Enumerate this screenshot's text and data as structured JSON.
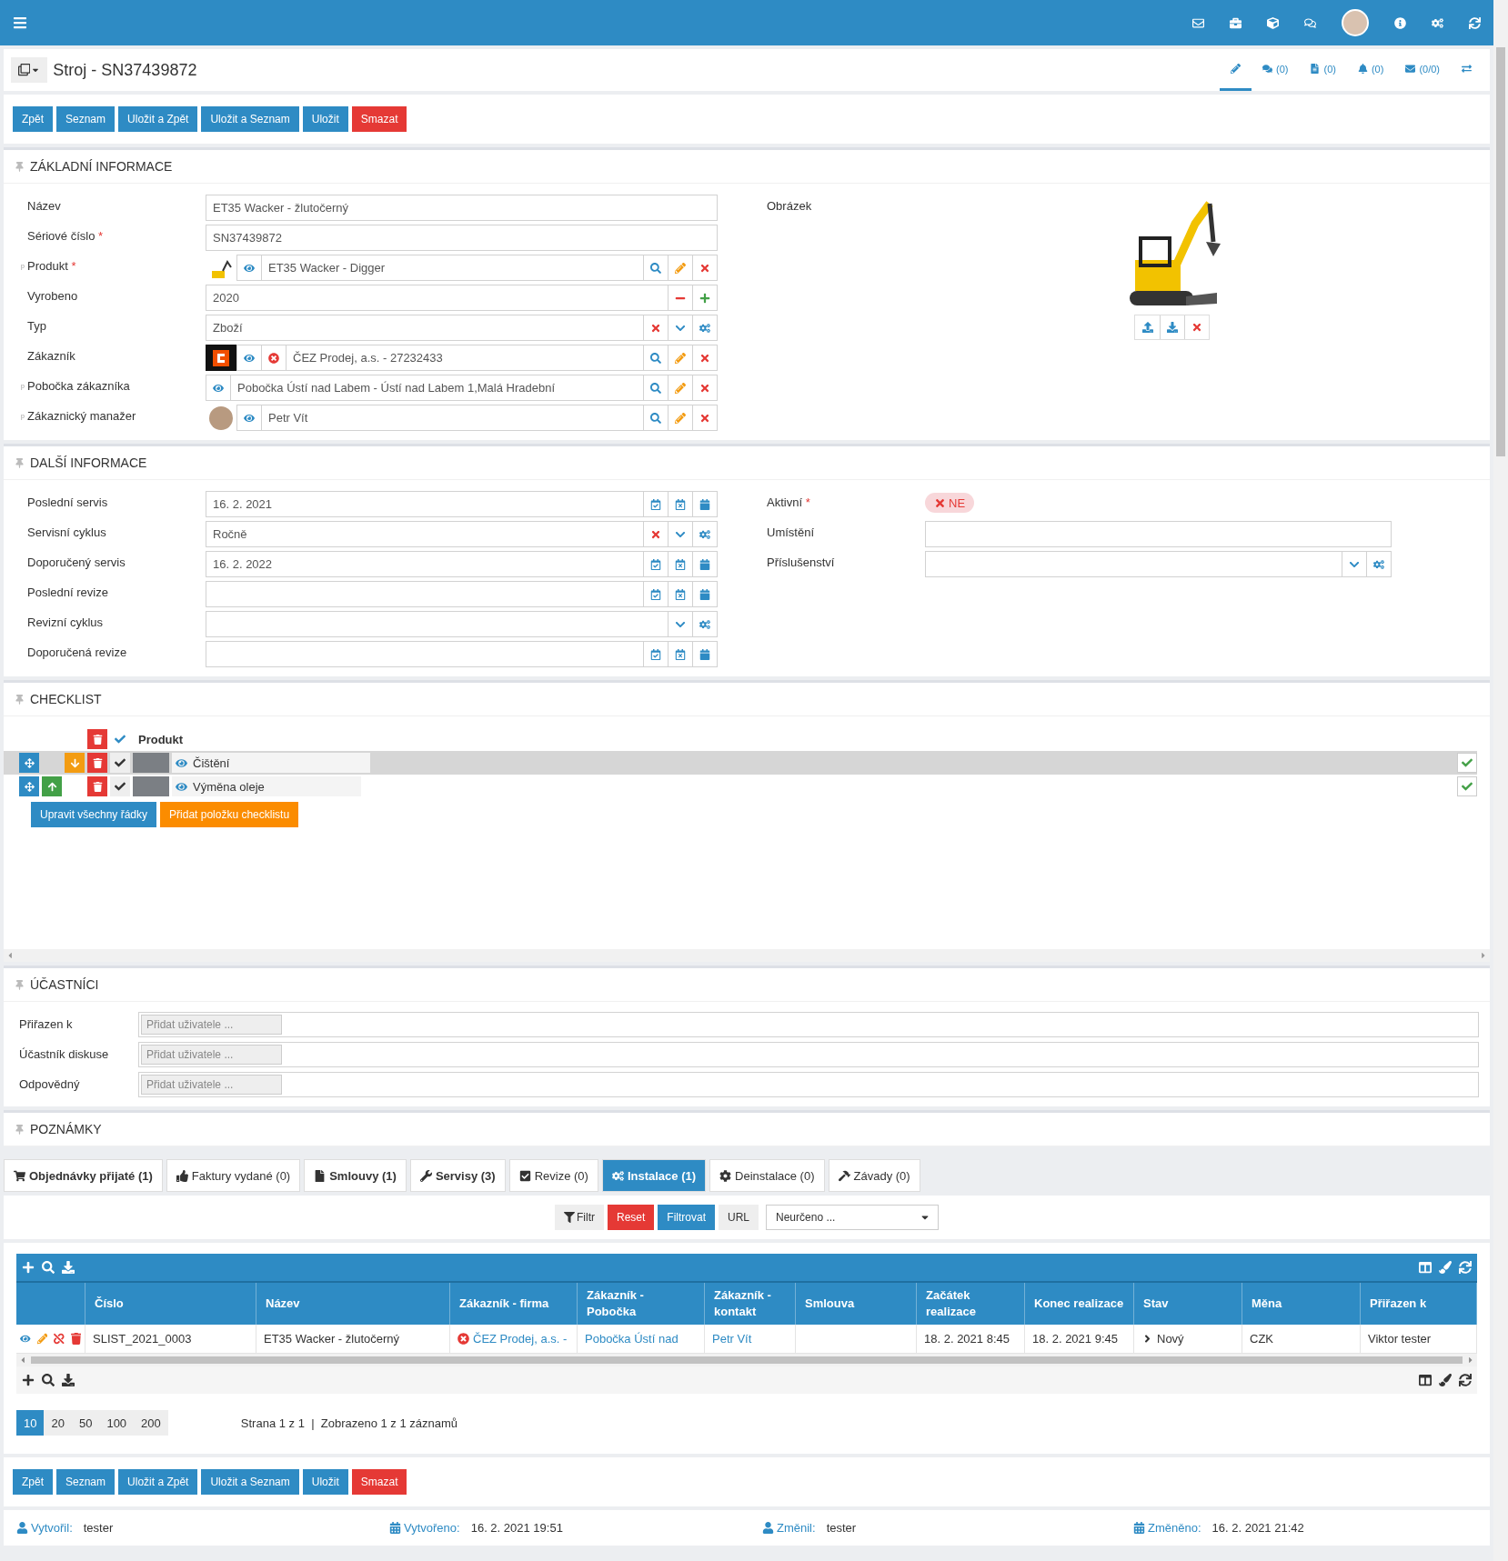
{
  "header": {
    "title": "Stroj - SN37439872",
    "tabs": [
      {
        "kind": "edit",
        "selected": true
      },
      {
        "kind": "comments",
        "count": "(0)",
        "selected": false
      },
      {
        "kind": "documents",
        "count": "(0)",
        "selected": false
      },
      {
        "kind": "bell",
        "count": "(0)",
        "selected": false
      },
      {
        "kind": "mail",
        "count": "(0/0)",
        "selected": false
      },
      {
        "kind": "swap",
        "selected": false
      }
    ]
  },
  "actions_top": [
    {
      "label": "Zpět",
      "kind": "primary"
    },
    {
      "label": "Seznam",
      "kind": "primary"
    },
    {
      "label": "Uložit a Zpět",
      "kind": "primary"
    },
    {
      "label": "Uložit a Seznam",
      "kind": "primary"
    },
    {
      "label": "Uložit",
      "kind": "primary"
    },
    {
      "label": "Smazat",
      "kind": "danger"
    }
  ],
  "basic": {
    "title": "ZÁKLADNÍ INFORMACE",
    "fields": [
      {
        "label": "Název",
        "kind": "text",
        "value": "ET35 Wacker - žlutočerný"
      },
      {
        "label": "Sériové číslo",
        "required_mark": "*",
        "kind": "text",
        "value": "SN37439872"
      },
      {
        "label": "Produkt",
        "prefix": "p",
        "required_mark": "*",
        "kind": "lookup",
        "thumb": {
          "kind": "machine"
        },
        "value": "ET35 Wacker - Digger"
      },
      {
        "label": "Vyrobeno",
        "kind": "number",
        "value": "2020"
      },
      {
        "label": "Typ",
        "kind": "select",
        "value": "Zboží"
      },
      {
        "label": "Zákazník",
        "kind": "lookup",
        "thumb": {
          "kind": "logo"
        },
        "unlink": true,
        "value": "ČEZ Prodej, a.s. - 27232433"
      },
      {
        "label": "Pobočka zákazníka",
        "prefix": "p",
        "kind": "lookup",
        "value": "Pobočka Ústí nad Labem - Ústí nad Labem 1,Malá Hradební"
      },
      {
        "label": "Zákaznický manažer",
        "prefix": "p",
        "kind": "lookup",
        "thumb": {
          "kind": "person"
        },
        "value": "Petr Vít"
      }
    ],
    "image": {
      "label": "Obrázek"
    }
  },
  "more": {
    "title": "DALŠÍ INFORMACE",
    "fields": [
      {
        "label": "Poslední servis",
        "kind": "date",
        "value": "16. 2. 2021"
      },
      {
        "label": "Servisní cyklus",
        "kind": "select",
        "value": "Ročně"
      },
      {
        "label": "Doporučený servis",
        "kind": "date",
        "value": "16. 2. 2022"
      },
      {
        "label": "Poslední revize",
        "kind": "date"
      },
      {
        "label": "Revizní cyklus",
        "kind": "choice"
      },
      {
        "label": "Doporučená revize",
        "kind": "date"
      }
    ],
    "right": [
      {
        "label": "Aktivní",
        "required_mark": "*",
        "kind": "toggle",
        "on": false,
        "value": "NE"
      },
      {
        "label": "Umístění",
        "kind": "text"
      },
      {
        "label": "Příslušenství",
        "kind": "choice"
      }
    ]
  },
  "checklist": {
    "title": "CHECKLIST",
    "heading": "Produkt",
    "items": [
      {
        "label": "Čištění",
        "up": false,
        "down": true,
        "done": true,
        "selected": true,
        "checked": true
      },
      {
        "label": "Výměna oleje",
        "up": true,
        "down": false,
        "done": true,
        "selected": false,
        "checked": true
      }
    ],
    "buttons": [
      {
        "label": "Upravit všechny řádky",
        "kind": "primary"
      },
      {
        "label": "Přidat položku checklistu",
        "kind": "warning"
      }
    ]
  },
  "participants": {
    "title": "ÚČASTNÍCI",
    "rows": [
      {
        "label": "Přiřazen k",
        "placeholder": "Přidat uživatele ..."
      },
      {
        "label": "Účastník diskuse",
        "placeholder": "Přidat uživatele ..."
      },
      {
        "label": "Odpovědný",
        "placeholder": "Přidat uživatele ..."
      }
    ]
  },
  "notes": {
    "title": "POZNÁMKY"
  },
  "tabs": [
    {
      "kind": "cart",
      "label": "Objednávky přijaté (1)",
      "nonempty": true,
      "selected": false
    },
    {
      "kind": "thumb",
      "label": "Faktury vydané (0)",
      "nonempty": false,
      "selected": false
    },
    {
      "kind": "file",
      "label": "Smlouvy (1)",
      "nonempty": true,
      "selected": false
    },
    {
      "kind": "wrench",
      "label": "Servisy (3)",
      "nonempty": true,
      "selected": false
    },
    {
      "kind": "checkbox",
      "label": "Revize (0)",
      "nonempty": false,
      "selected": false
    },
    {
      "kind": "cogs",
      "label": "Instalace (1)",
      "nonempty": true,
      "selected": true
    },
    {
      "kind": "cog",
      "label": "Deinstalace (0)",
      "nonempty": false,
      "selected": false
    },
    {
      "kind": "hammer",
      "label": "Závady (0)",
      "nonempty": false,
      "selected": false
    }
  ],
  "filter": {
    "buttons": [
      {
        "label": "Filtr",
        "kind": "filter"
      },
      {
        "label": "Reset",
        "kind": "danger"
      },
      {
        "label": "Filtrovat",
        "kind": "primary"
      },
      {
        "label": "URL",
        "kind": "plain"
      }
    ],
    "select": "Neurčeno ..."
  },
  "table": {
    "columns": [
      "Číslo",
      "Název",
      "Zákazník - firma",
      "Zákazník - Pobočka",
      "Zákazník - kontakt",
      "Smlouva",
      "Začátek realizace",
      "Konec realizace",
      "Stav",
      "Měna",
      "Přiřazen k"
    ],
    "rows": [
      [
        {
          "kind": "text",
          "text": "SLIST_2021_0003"
        },
        {
          "kind": "text",
          "text": "ET35 Wacker - žlutočerný"
        },
        {
          "kind": "unlink",
          "text": "ČEZ Prodej, a.s. -"
        },
        {
          "kind": "link",
          "text": "Pobočka Ústí nad"
        },
        {
          "kind": "link",
          "text": "Petr Vít"
        },
        null,
        {
          "kind": "text",
          "text": "18. 2. 2021 8:45"
        },
        {
          "kind": "text",
          "text": "18. 2. 2021 9:45"
        },
        {
          "kind": "status",
          "text": "Nový"
        },
        {
          "kind": "text",
          "text": "CZK"
        },
        {
          "kind": "text",
          "text": "Viktor tester"
        }
      ]
    ]
  },
  "pagination": {
    "sizes": [
      {
        "label": "10",
        "selected": true
      },
      {
        "label": "20",
        "selected": false
      },
      {
        "label": "50",
        "selected": false
      },
      {
        "label": "100",
        "selected": false
      },
      {
        "label": "200",
        "selected": false
      }
    ],
    "info": "Strana 1 z 1  |  Zobrazeno 1 z 1 záznamů"
  },
  "actions_bottom": [
    {
      "label": "Zpět",
      "kind": "primary"
    },
    {
      "label": "Seznam",
      "kind": "primary"
    },
    {
      "label": "Uložit a Zpět",
      "kind": "primary"
    },
    {
      "label": "Uložit a Seznam",
      "kind": "primary"
    },
    {
      "label": "Uložit",
      "kind": "primary"
    },
    {
      "label": "Smazat",
      "kind": "danger"
    }
  ],
  "footer": [
    {
      "kind": "user",
      "label": "Vytvořil:",
      "value": "tester"
    },
    {
      "kind": "date",
      "label": "Vytvořeno:",
      "value": "16. 2. 2021 19:51"
    },
    {
      "kind": "user",
      "label": "Změnil:",
      "value": "tester"
    },
    {
      "kind": "date",
      "label": "Změněno:",
      "value": "16. 2. 2021 21:42"
    }
  ]
}
